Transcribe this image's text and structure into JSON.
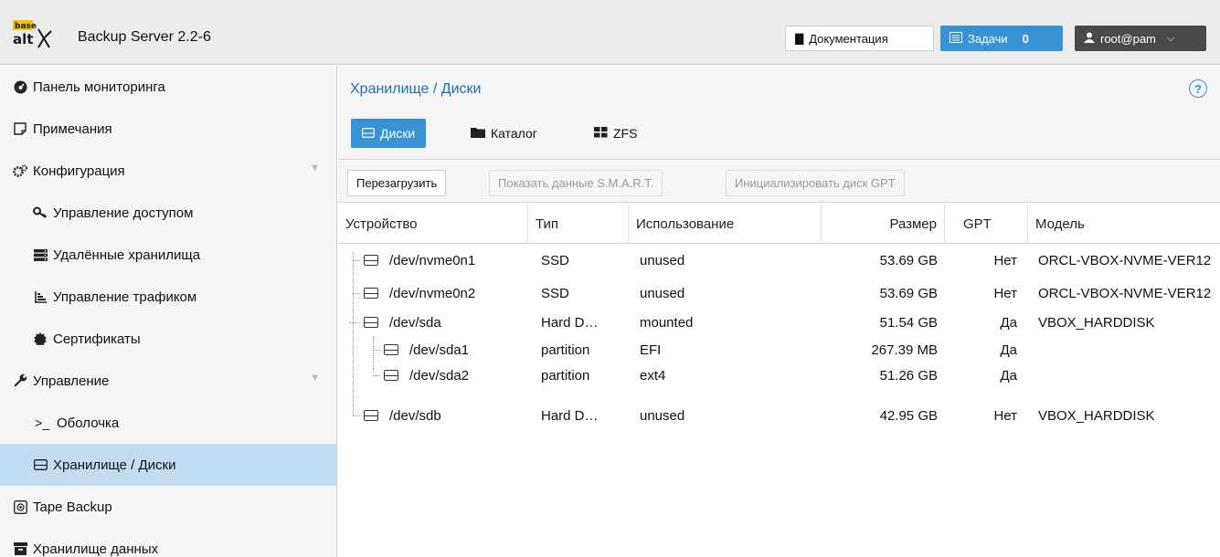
{
  "header": {
    "logo_text_top": "base",
    "logo_text_bottom": "alt",
    "title": "Backup Server 2.2-6",
    "docs_label": "Документация",
    "tasks_label": "Задачи",
    "tasks_count": "0",
    "user_label": "root@pam"
  },
  "sidebar": {
    "items": [
      {
        "label": "Панель мониторинга",
        "icon": "dashboard-icon"
      },
      {
        "label": "Примечания",
        "icon": "notes-icon"
      },
      {
        "label": "Конфигурация",
        "icon": "gears-icon"
      },
      {
        "label": "Управление доступом",
        "icon": "key-icon"
      },
      {
        "label": "Удалённые хранилища",
        "icon": "server-icon"
      },
      {
        "label": "Управление трафиком",
        "icon": "traffic-icon"
      },
      {
        "label": "Сертификаты",
        "icon": "certificate-icon"
      },
      {
        "label": "Управление",
        "icon": "wrench-icon"
      },
      {
        "label": "Оболочка",
        "icon": "terminal-icon"
      },
      {
        "label": "Хранилище / Диски",
        "icon": "disk-icon"
      },
      {
        "label": "Tape Backup",
        "icon": "tape-icon"
      },
      {
        "label": "Хранилище данных",
        "icon": "archive-icon"
      }
    ]
  },
  "main": {
    "breadcrumb": "Хранилище / Диски",
    "tabs": [
      {
        "label": "Диски"
      },
      {
        "label": "Каталог"
      },
      {
        "label": "ZFS"
      }
    ],
    "toolbar": {
      "reload": "Перезагрузить",
      "smart": "Показать данные S.M.A.R.T.",
      "init_gpt": "Инициализировать диск GPT"
    },
    "columns": [
      "Устройство",
      "Тип",
      "Использование",
      "Размер",
      "GPT",
      "Модель"
    ],
    "rows": [
      {
        "device": "/dev/nvme0n1",
        "type": "SSD",
        "usage": "unused",
        "size": "53.69 GB",
        "gpt": "Нет",
        "model": "ORCL-VBOX-NVME-VER12"
      },
      {
        "device": "/dev/nvme0n2",
        "type": "SSD",
        "usage": "unused",
        "size": "53.69 GB",
        "gpt": "Нет",
        "model": "ORCL-VBOX-NVME-VER12"
      },
      {
        "device": "/dev/sda",
        "type": "Hard D…",
        "usage": "mounted",
        "size": "51.54 GB",
        "gpt": "Да",
        "model": "VBOX_HARDDISK"
      },
      {
        "device": "/dev/sda1",
        "type": "partition",
        "usage": "EFI",
        "size": "267.39 MB",
        "gpt": "Да",
        "model": ""
      },
      {
        "device": "/dev/sda2",
        "type": "partition",
        "usage": "ext4",
        "size": "51.26 GB",
        "gpt": "Да",
        "model": ""
      },
      {
        "device": "/dev/sdb",
        "type": "Hard D…",
        "usage": "unused",
        "size": "42.95 GB",
        "gpt": "Нет",
        "model": "VBOX_HARDDISK"
      }
    ]
  },
  "colors": {
    "accent": "#3892d4",
    "sidebar_active": "#c2ddf2",
    "breadcrumb": "#1f6fb2",
    "user_button": "#494949"
  }
}
